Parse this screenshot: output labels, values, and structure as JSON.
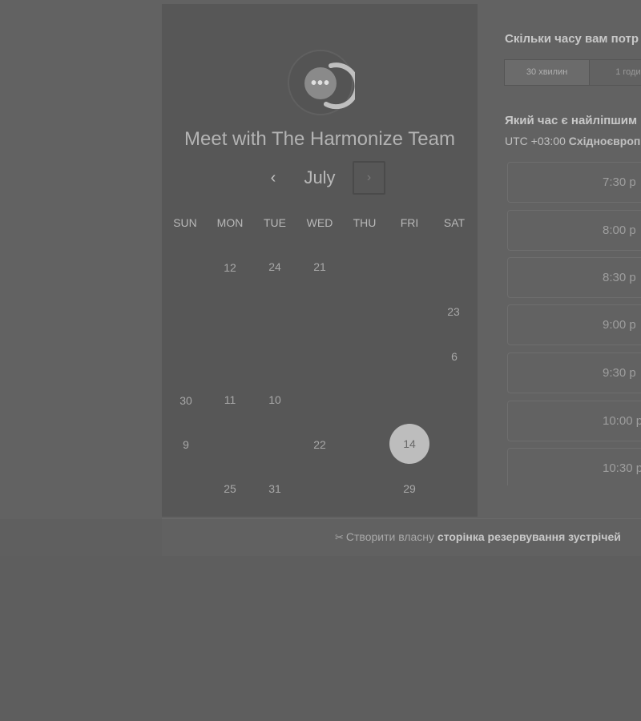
{
  "calendar": {
    "title": "Meet with The Harmonize Team",
    "month": "July",
    "prev_icon": "‹",
    "next_icon": "›",
    "weekdays": [
      "SUN",
      "MON",
      "TUE",
      "WED",
      "THU",
      "FRI",
      "SAT"
    ],
    "days": [
      "12",
      "24",
      "21",
      "23",
      "6",
      "30",
      "11",
      "10",
      "9",
      "22",
      "14",
      "25",
      "31",
      "29"
    ],
    "selected_day": "14"
  },
  "booking": {
    "duration_question": "Скільки часу вам потр",
    "duration_options": [
      "30 хвилин",
      "1 годи"
    ],
    "selected_duration": "30 хвилин",
    "time_question": "Який час є найліпшим",
    "timezone_prefix": "UTC +03:00",
    "timezone_name": "Східноєвроп",
    "slots": [
      "7:30 p",
      "8:00 p",
      "8:30 p",
      "9:00 p",
      "9:30 p",
      "10:00 p",
      "10:30 p"
    ]
  },
  "footer": {
    "prefix": "Створити власну",
    "link": "сторінка резервування зустрічей"
  }
}
